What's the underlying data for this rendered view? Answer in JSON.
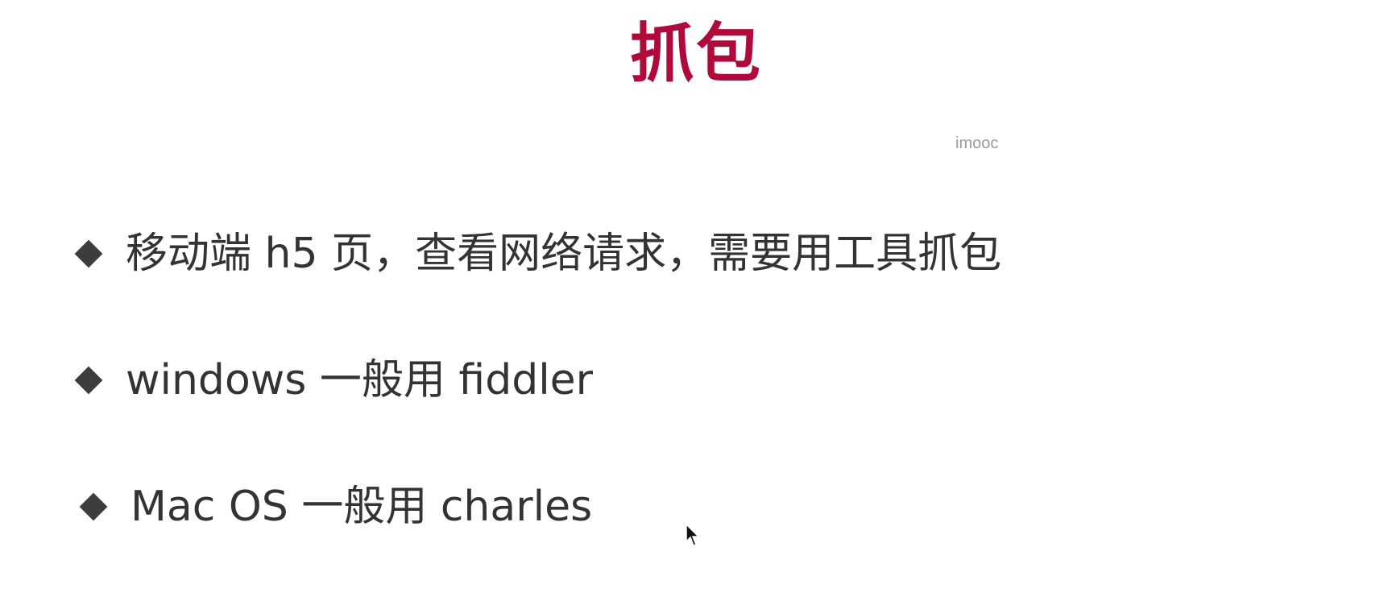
{
  "slide": {
    "title": "抓包",
    "watermark": "imooc",
    "bullets": [
      {
        "text": "移动端 h5 页，查看网络请求，需要用工具抓包"
      },
      {
        "text": "windows 一般用 fiddler"
      },
      {
        "text": "Mac OS 一般用 charles"
      }
    ],
    "bullet_icon": "diamond-icon",
    "cursor_icon": "mouse-pointer-icon"
  },
  "colors": {
    "title": "#b00a3c",
    "text": "#333333",
    "watermark": "#9a9a9a",
    "background": "#ffffff"
  }
}
